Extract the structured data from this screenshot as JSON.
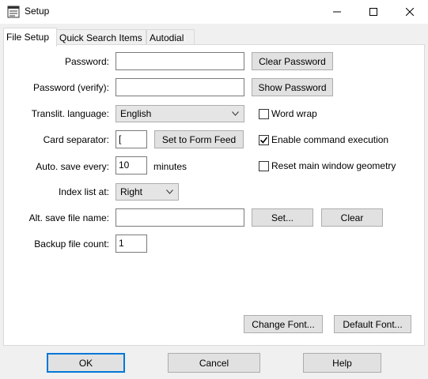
{
  "window": {
    "title": "Setup"
  },
  "tabs": [
    {
      "label": "File Setup"
    },
    {
      "label": "Quick Search Items"
    },
    {
      "label": "Autodial"
    }
  ],
  "form": {
    "password": {
      "label": "Password:",
      "value": ""
    },
    "password_verify": {
      "label": "Password (verify):",
      "value": ""
    },
    "translit": {
      "label": "Translit. language:",
      "value": "English"
    },
    "card_sep": {
      "label": "Card separator:",
      "value": "["
    },
    "auto_save": {
      "label": "Auto. save every:",
      "value": "10",
      "unit": "minutes"
    },
    "index_list": {
      "label": "Index list at:",
      "value": "Right"
    },
    "alt_save": {
      "label": "Alt. save file name:",
      "value": ""
    },
    "backup": {
      "label": "Backup file count:",
      "value": "1"
    }
  },
  "buttons": {
    "clear_password": "Clear Password",
    "show_password": "Show Password",
    "set_form_feed": "Set to Form Feed",
    "set": "Set...",
    "clear": "Clear",
    "change_font": "Change Font...",
    "default_font": "Default Font...",
    "ok": "OK",
    "cancel": "Cancel",
    "help": "Help"
  },
  "checkboxes": {
    "word_wrap": {
      "label": "Word wrap",
      "checked": false
    },
    "enable_cmd": {
      "label": "Enable command execution",
      "checked": true
    },
    "reset_geom": {
      "label": "Reset main window geometry",
      "checked": false
    }
  }
}
